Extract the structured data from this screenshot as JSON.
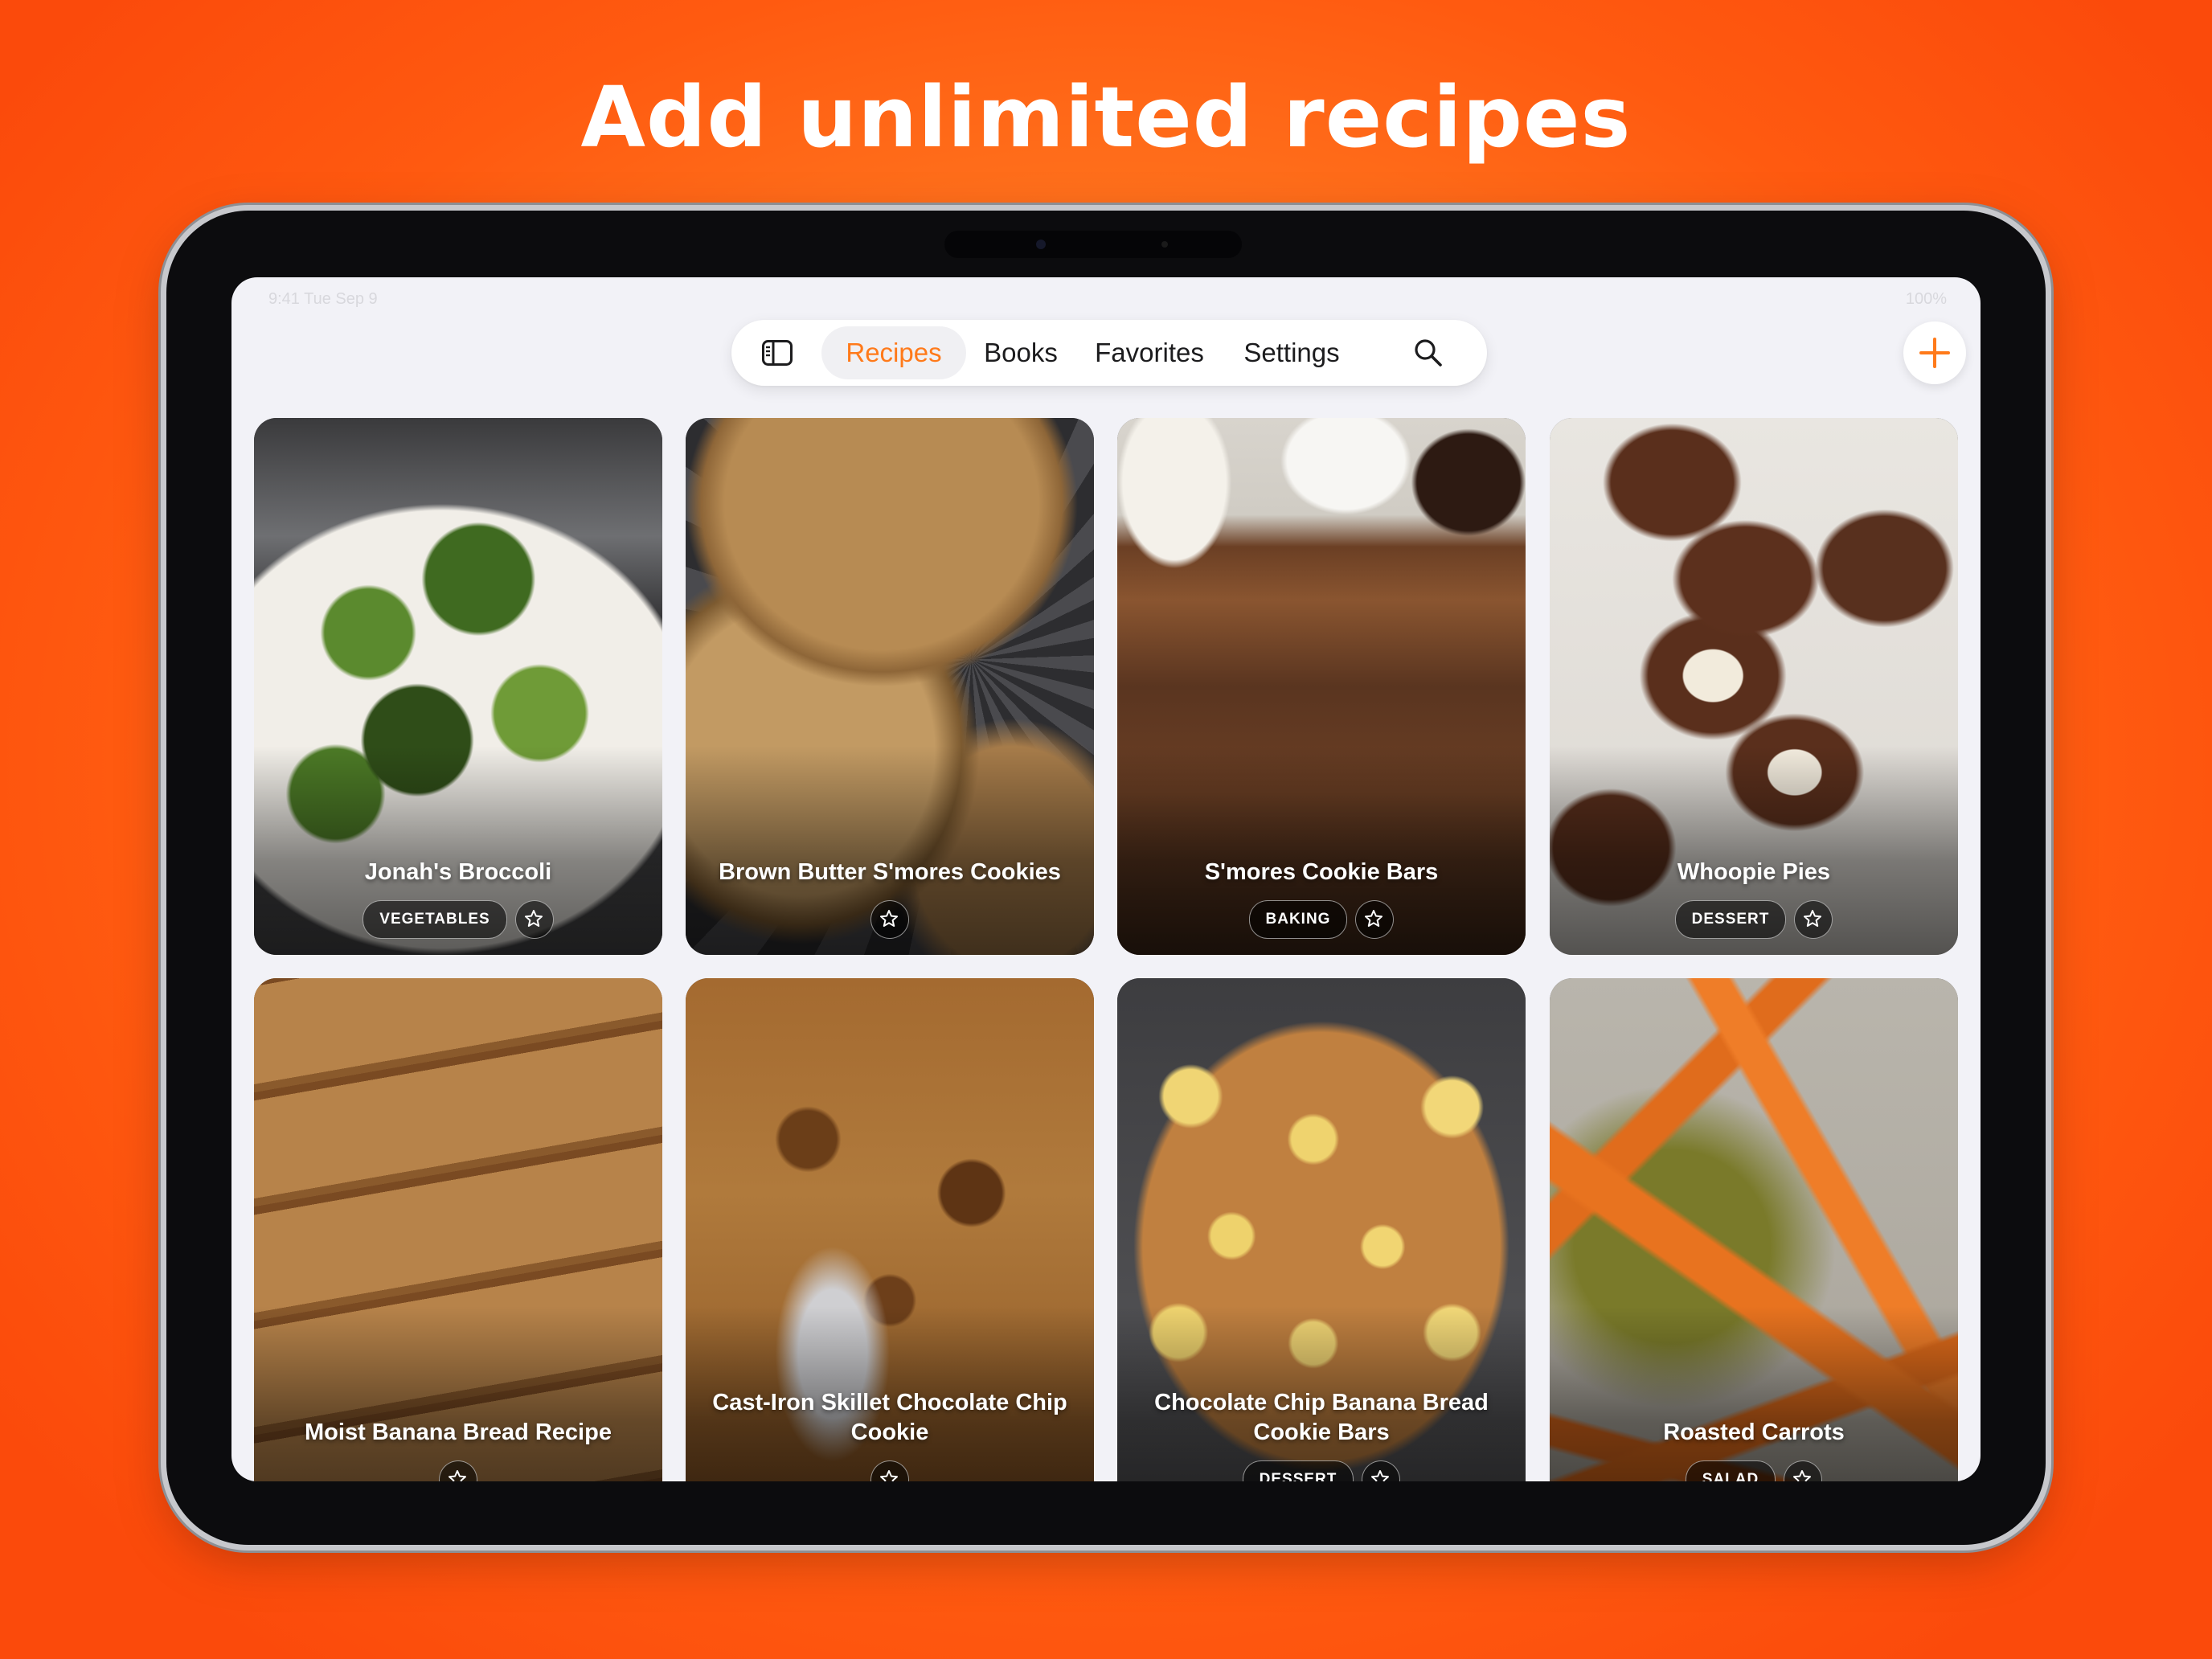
{
  "headline": "Add unlimited recipes",
  "status_bar": {
    "time": "9:41 Tue Sep 9",
    "battery": "100%"
  },
  "nav": {
    "tabs": [
      "Recipes",
      "Books",
      "Favorites",
      "Settings"
    ],
    "active_tab": "Recipes",
    "icons": [
      "sidebar-icon",
      "search-icon",
      "plus-icon"
    ]
  },
  "colors": {
    "accent": "#ff7a1a",
    "background": "#ff6a16",
    "screen": "#f2f2f7"
  },
  "recipes": [
    {
      "title": "Jonah's Broccoli",
      "category": "VEGETABLES"
    },
    {
      "title": "Brown Butter S'mores Cookies",
      "category": ""
    },
    {
      "title": "S'mores Cookie Bars",
      "category": "BAKING"
    },
    {
      "title": "Whoopie Pies",
      "category": "DESSERT"
    },
    {
      "title": "Moist Banana Bread Recipe",
      "category": ""
    },
    {
      "title": "Cast-Iron Skillet Chocolate Chip Cookie",
      "category": ""
    },
    {
      "title": "Chocolate Chip Banana Bread Cookie Bars",
      "category": "DESSERT"
    },
    {
      "title": "Roasted Carrots",
      "category": "SALAD"
    }
  ]
}
